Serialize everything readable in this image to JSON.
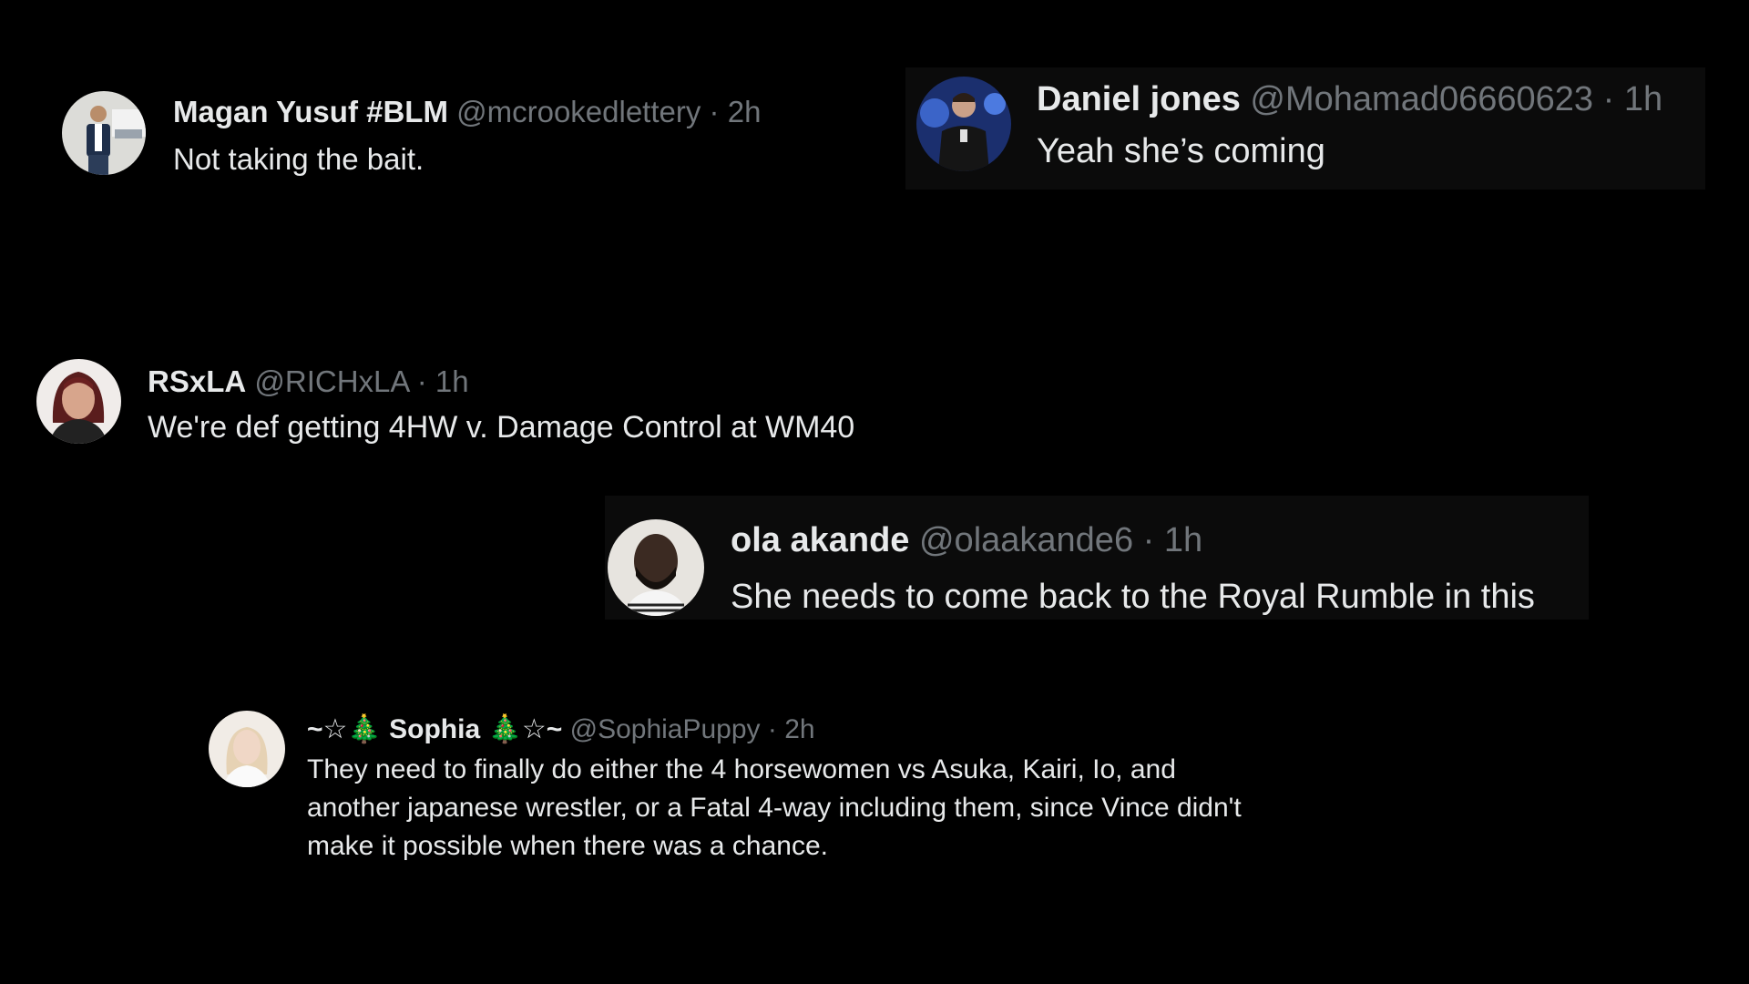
{
  "colors": {
    "background": "#000000",
    "text_primary": "#e7e9ea",
    "text_secondary": "#71767b",
    "card_background": "#0b0b0b"
  },
  "tweets": [
    {
      "name": "Magan Yusuf #BLM",
      "handle": "@mcrookedlettery",
      "separator": "·",
      "time": "2h",
      "text": "Not taking the bait.",
      "avatar_icon": "avatar-man-standing"
    },
    {
      "name": "Daniel jones",
      "handle": "@Mohamad06660623",
      "separator": "·",
      "time": "1h",
      "text": "Yeah she’s coming",
      "avatar_icon": "avatar-man-on-stage"
    },
    {
      "name": "RSxLA",
      "handle": "@RICHxLA",
      "separator": "·",
      "time": "1h",
      "text": "We're def getting 4HW v. Damage Control at WM40",
      "avatar_icon": "avatar-woman-red-hair"
    },
    {
      "name": "ola akande",
      "handle": "@olaakande6",
      "separator": "·",
      "time": "1h",
      "text": "She needs to come back to the Royal Rumble in this",
      "avatar_icon": "avatar-man-bearded"
    },
    {
      "name_prefix": "~☆",
      "name_tree_icon": "🎄",
      "name": "Sophia",
      "name_suffix": "☆~",
      "handle": "@SophiaPuppy",
      "separator": "·",
      "time": "2h",
      "text": "They need to finally do either the 4 horsewomen vs Asuka, Kairi, Io, and another japanese wrestler, or a Fatal 4-way including them, since Vince didn't make it possible when there was a chance.",
      "avatar_icon": "avatar-woman-blonde"
    }
  ]
}
